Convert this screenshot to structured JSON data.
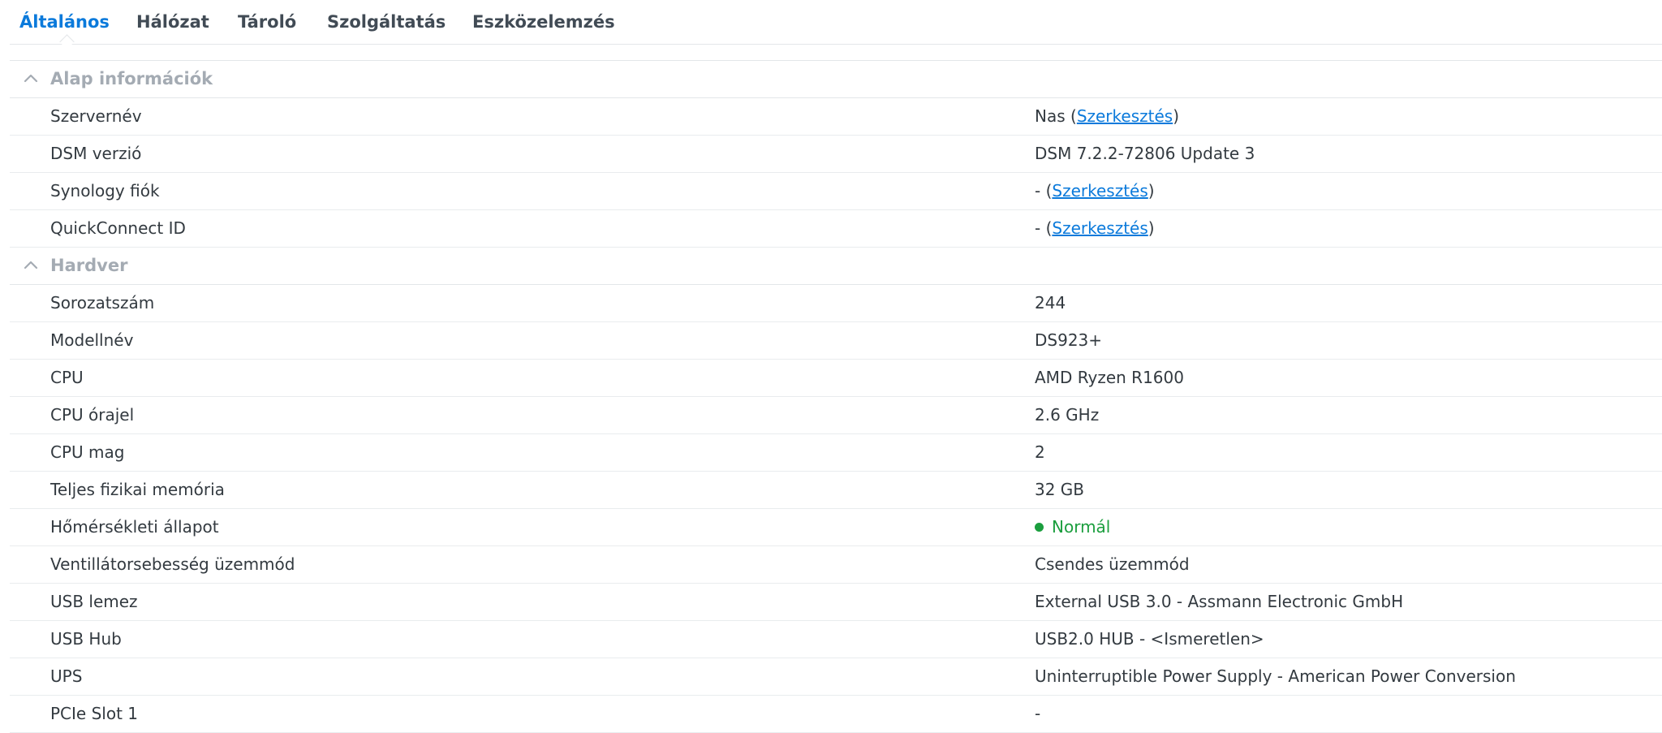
{
  "tabs": [
    {
      "label": "Általános",
      "active": true
    },
    {
      "label": "Hálózat"
    },
    {
      "label": "Tároló"
    },
    {
      "label": "Szolgáltatás"
    },
    {
      "label": "Eszközelemzés"
    }
  ],
  "icons": {
    "collapse": "chevron-up-icon",
    "status": "status-dot-icon"
  },
  "colors": {
    "accent": "#0b7adb",
    "status_normal": "#1b9e3e"
  },
  "sections": {
    "basic": {
      "title": "Alap információk",
      "rows": [
        {
          "label": "Szervernév",
          "value": "Nas",
          "open": " (",
          "link": "Szerkesztés",
          "close": ")"
        },
        {
          "label": "DSM verzió",
          "value": "DSM 7.2.2-72806 Update 3"
        },
        {
          "label": "Synology fiók",
          "value": "-",
          "open": " (",
          "link": "Szerkesztés",
          "close": ")"
        },
        {
          "label": "QuickConnect ID",
          "value": "-",
          "open": " (",
          "link": "Szerkesztés",
          "close": ")"
        }
      ]
    },
    "hardware": {
      "title": "Hardver",
      "rows": [
        {
          "label": "Sorozatszám",
          "value": "244"
        },
        {
          "label": "Modellnév",
          "value": "DS923+"
        },
        {
          "label": "CPU",
          "value": "AMD Ryzen R1600"
        },
        {
          "label": "CPU órajel",
          "value": "2.6 GHz"
        },
        {
          "label": "CPU mag",
          "value": "2"
        },
        {
          "label": "Teljes fizikai memória",
          "value": "32 GB"
        },
        {
          "label": "Hőmérsékleti állapot",
          "value": "Normál"
        },
        {
          "label": "Ventillátorsebesség üzemmód",
          "value": "Csendes üzemmód"
        },
        {
          "label": "USB lemez",
          "value": "External USB 3.0 - Assmann Electronic GmbH"
        },
        {
          "label": "USB Hub",
          "value": "USB2.0 HUB - <Ismeretlen>"
        },
        {
          "label": "UPS",
          "value": "Uninterruptible Power Supply - American Power Conversion"
        },
        {
          "label": "PCIe Slot 1",
          "value": "-"
        }
      ]
    }
  }
}
